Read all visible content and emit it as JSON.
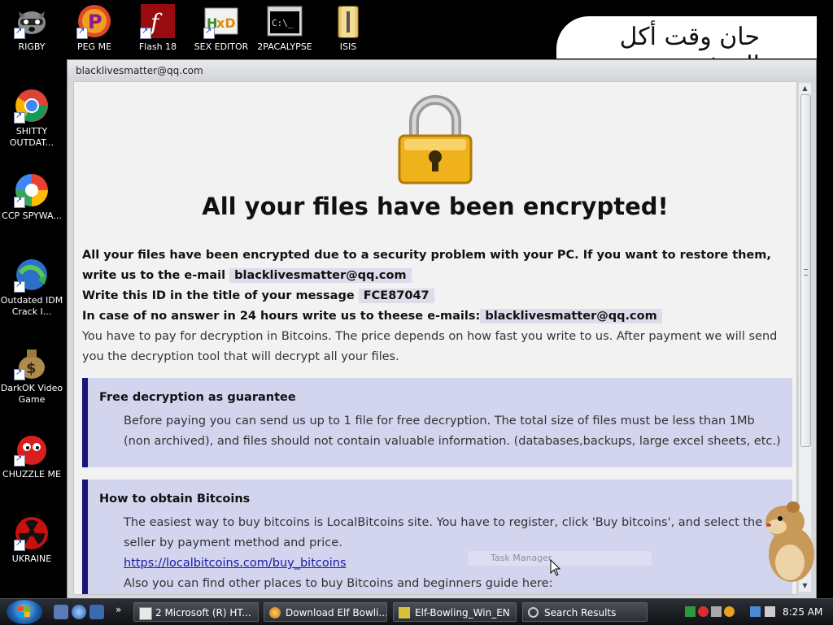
{
  "desktop": {
    "top_icons": [
      {
        "label": "RIGBY",
        "icon": "raccoon-icon"
      },
      {
        "label": "PEG ME",
        "icon": "peg-app-icon"
      },
      {
        "label": "Flash 18",
        "icon": "flash-icon"
      },
      {
        "label": "SEX EDITOR",
        "icon": "hxd-icon"
      },
      {
        "label": "2PACALYPSE",
        "icon": "console-icon"
      },
      {
        "label": "ISIS",
        "icon": "folder-icon"
      }
    ],
    "left_icons": [
      {
        "label": "SHITTY OUTDAT...",
        "icon": "chrome-icon"
      },
      {
        "label": "CCP SPYWA...",
        "icon": "pinwheel-icon"
      },
      {
        "label": "Outdated IDM Crack I...",
        "icon": "idm-globe-icon"
      },
      {
        "label": "DarkOK Video Game",
        "icon": "money-bag-icon"
      },
      {
        "label": "CHUZZLE ME",
        "icon": "chuzzle-icon"
      },
      {
        "label": "UKRAINE",
        "icon": "radiation-icon"
      }
    ],
    "banner_text": "حان وقت أكل القرف"
  },
  "window": {
    "title": "blacklivesmatter@qq.com",
    "headline": "All your files have been encrypted!",
    "intro_1": "All your files have been encrypted due to a security problem with your PC. If you want to restore them, write us to the e-mail",
    "email": "blacklivesmatter@qq.com",
    "id_label": "Write this ID in the title of your message",
    "id_value": "FCE87047",
    "no_answer_label": "In case of no answer in 24 hours write us to theese e-mails:",
    "email_2": "blacklivesmatter@qq.com",
    "payment_text": "You have to pay for decryption in Bitcoins. The price depends on how fast you write to us. After payment we will send you the decryption tool that will decrypt all your files.",
    "box_free": {
      "title": "Free decryption as guarantee",
      "text": "Before paying you can send us up to 1 file for free decryption. The total size of files must be less than 1Mb (non archived), and files should not contain valuable information. (databases,backups, large excel sheets, etc.)"
    },
    "box_bitcoin": {
      "title": "How to obtain Bitcoins",
      "text": "The easiest way to buy bitcoins is LocalBitcoins site. You have to register, click 'Buy bitcoins', and select the seller by payment method and price.",
      "link": "https://localbitcoins.com/buy_bitcoins",
      "text_2": "Also you can find other places to buy Bitcoins and beginners guide here:"
    },
    "ghost_tooltip": "Task Manager"
  },
  "taskbar": {
    "tasks": [
      {
        "label": "2 Microsoft (R) HT..."
      },
      {
        "label": "Download Elf Bowli..."
      },
      {
        "label": "Elf-Bowling_Win_EN"
      },
      {
        "label": "Search Results"
      }
    ],
    "clock": "8:25 AM"
  }
}
